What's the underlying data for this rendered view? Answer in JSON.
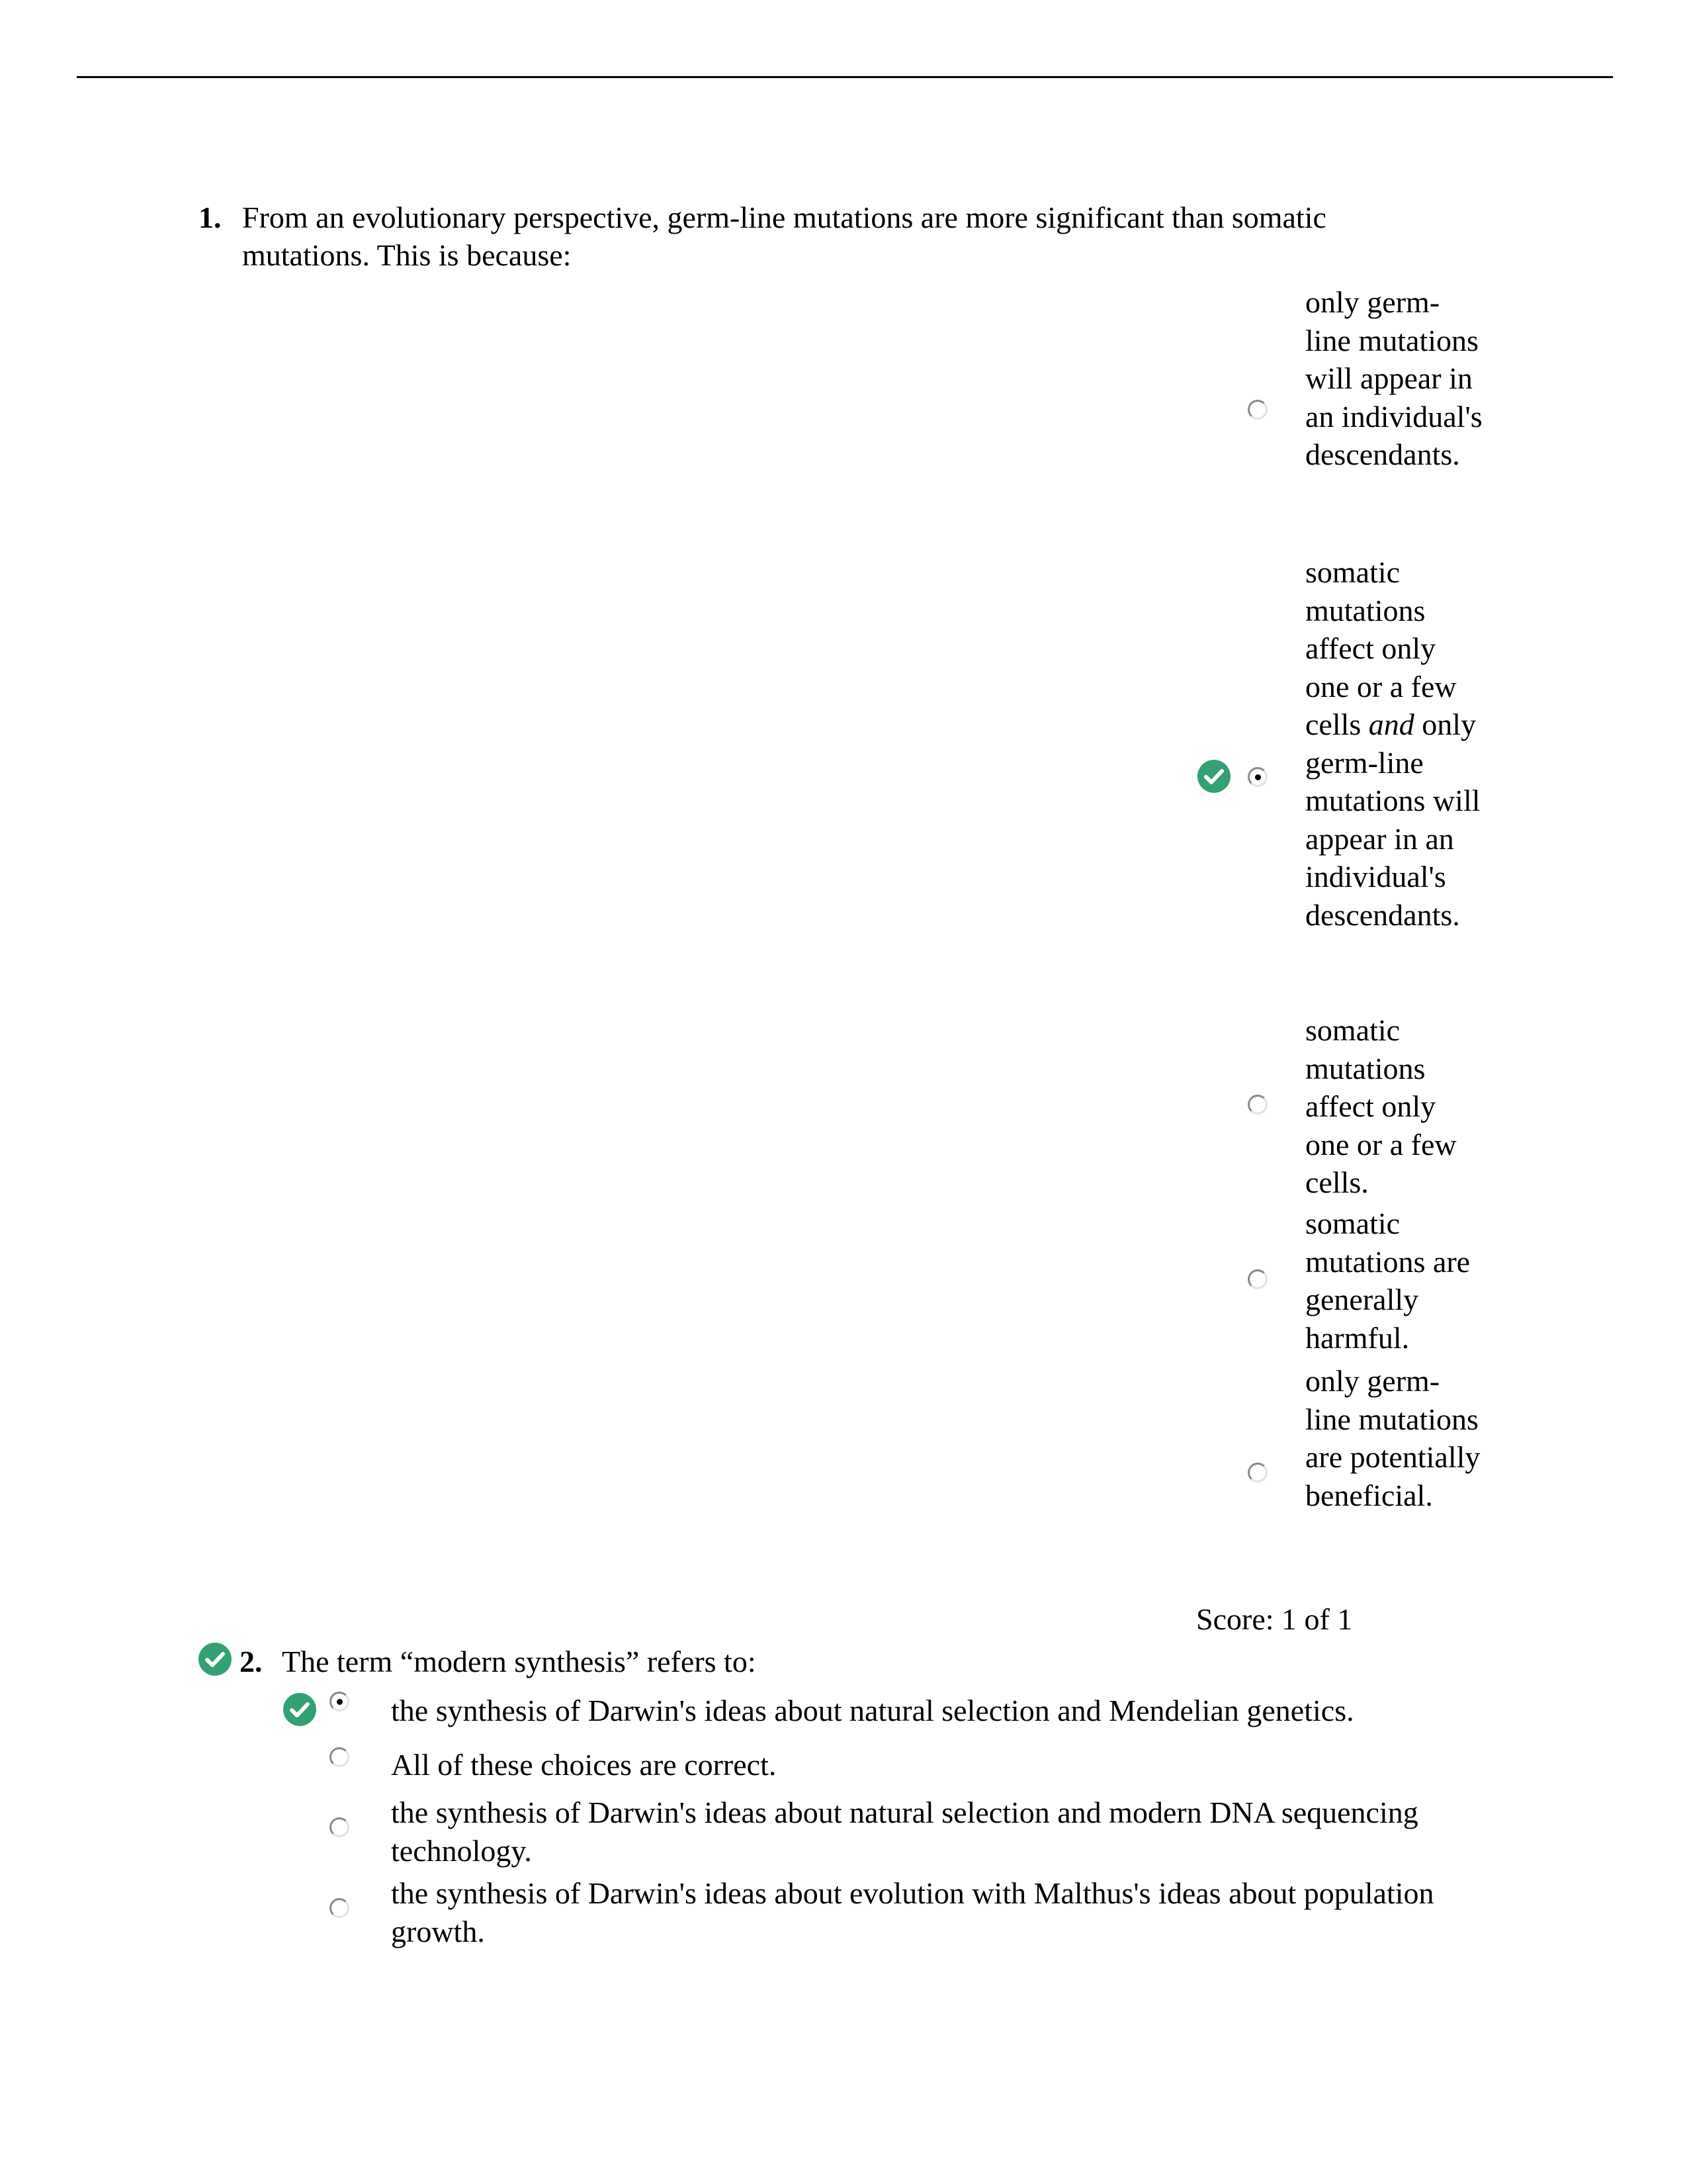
{
  "questions": [
    {
      "number": "1.",
      "stem": "From an evolutionary perspective, germ-line mutations are more significant than somatic mutations. This is because:",
      "graded_correct": false,
      "options": [
        {
          "text": "only germ-line mutations will appear in an individual's descendants.",
          "selected": false,
          "correct_marker": false
        },
        {
          "text_before": "somatic mutations affect only one or a few cells ",
          "text_italic": "and",
          "text_after": " only germ-line mutations will appear in an individual's descendants.",
          "selected": true,
          "correct_marker": true
        },
        {
          "text": "somatic mutations affect only one or a few cells.",
          "selected": false,
          "correct_marker": false
        },
        {
          "text": "somatic mutations are generally harmful.",
          "selected": false,
          "correct_marker": false
        },
        {
          "text": "only germ-line mutations are potentially beneficial.",
          "selected": false,
          "correct_marker": false
        }
      ],
      "score": "Score: 1 of 1"
    },
    {
      "number": "2.",
      "stem": "The term “modern synthesis” refers to:",
      "graded_correct": true,
      "options": [
        {
          "text": "the synthesis of Darwin's ideas about natural selection and Mendelian genetics.",
          "selected": true,
          "correct_marker": true
        },
        {
          "text": "All of these choices are correct.",
          "selected": false,
          "correct_marker": false
        },
        {
          "text": "the synthesis of Darwin's ideas about natural selection and modern DNA sequencing technology.",
          "selected": false,
          "correct_marker": false
        },
        {
          "text": "the synthesis of Darwin's ideas about evolution with Malthus's ideas about population growth.",
          "selected": false,
          "correct_marker": false
        }
      ]
    }
  ],
  "colors": {
    "correct_green": "#33a174",
    "rule": "#000000"
  },
  "icons": {
    "correct": "check-circle-icon",
    "radio": "radio-button-icon"
  }
}
